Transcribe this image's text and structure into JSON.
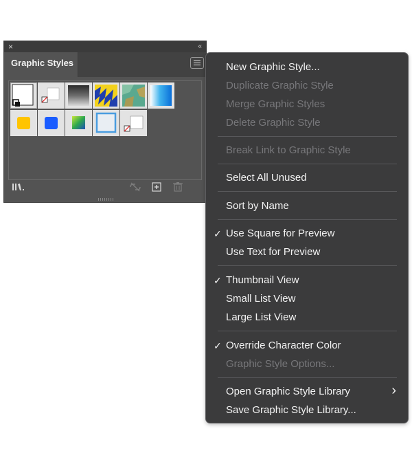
{
  "panel": {
    "tab_title": "Graphic Styles",
    "close_glyph": "×",
    "collapse_glyph": "‹‹"
  },
  "menu": {
    "items": [
      {
        "label": "New Graphic Style...",
        "enabled": true
      },
      {
        "label": "Duplicate Graphic Style",
        "enabled": false
      },
      {
        "label": "Merge Graphic Styles",
        "enabled": false
      },
      {
        "label": "Delete Graphic Style",
        "enabled": false
      },
      {
        "label": "Break Link to Graphic Style",
        "enabled": false
      },
      {
        "label": "Select All Unused",
        "enabled": true
      },
      {
        "label": "Sort by Name",
        "enabled": true
      },
      {
        "label": "Use Square for Preview",
        "enabled": true,
        "checked": true
      },
      {
        "label": "Use Text for Preview",
        "enabled": true
      },
      {
        "label": "Thumbnail View",
        "enabled": true,
        "checked": true
      },
      {
        "label": "Small List View",
        "enabled": true
      },
      {
        "label": "Large List View",
        "enabled": true
      },
      {
        "label": "Override Character Color",
        "enabled": true,
        "checked": true
      },
      {
        "label": "Graphic Style Options...",
        "enabled": false
      },
      {
        "label": "Open Graphic Style Library",
        "enabled": true,
        "submenu": true
      },
      {
        "label": "Save Graphic Style Library...",
        "enabled": true
      }
    ],
    "check_glyph": "✓",
    "submenu_glyph": "›"
  },
  "colors": {
    "panel_bg": "#535353",
    "menu_bg": "#3b3b3c",
    "menu_text": "#f2f2f2",
    "menu_text_disabled": "#77777a",
    "accent_blue": "#1a5cff",
    "accent_yellow": "#ffc400"
  },
  "icons": {
    "library": "library-icon",
    "break_link": "break-link-icon",
    "new_style": "new-style-icon",
    "delete": "trash-icon"
  }
}
